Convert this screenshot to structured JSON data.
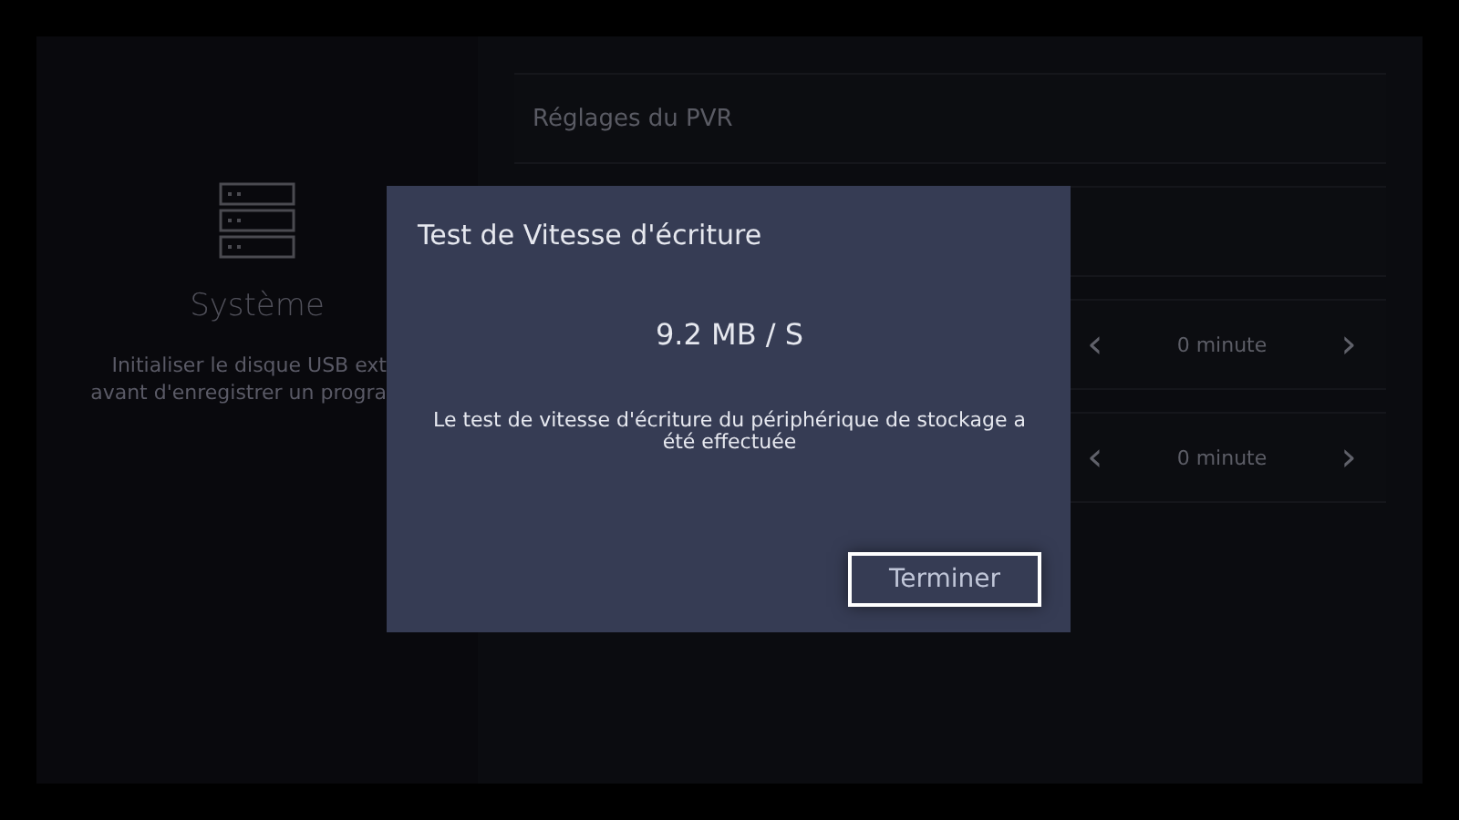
{
  "sidebar": {
    "title": "Système",
    "description": [
      "Initialiser le disque USB ext",
      "avant d'enregistrer un progra"
    ]
  },
  "settings": {
    "rows": [
      {
        "kind": "header",
        "label": "Réglages du PVR"
      },
      {
        "kind": "blank"
      },
      {
        "kind": "stepper",
        "value": "0 minute",
        "prev": "‹",
        "next": "›"
      },
      {
        "kind": "stepper",
        "value": "0 minute",
        "prev": "‹",
        "next": "›"
      }
    ]
  },
  "dialog": {
    "title": "Test de Vitesse d'écriture",
    "speed": "9.2 MB / S",
    "message": "Le test de vitesse d'écriture du périphérique de stockage a été effectuée",
    "button": {
      "label": "Terminer",
      "focused": true
    }
  }
}
